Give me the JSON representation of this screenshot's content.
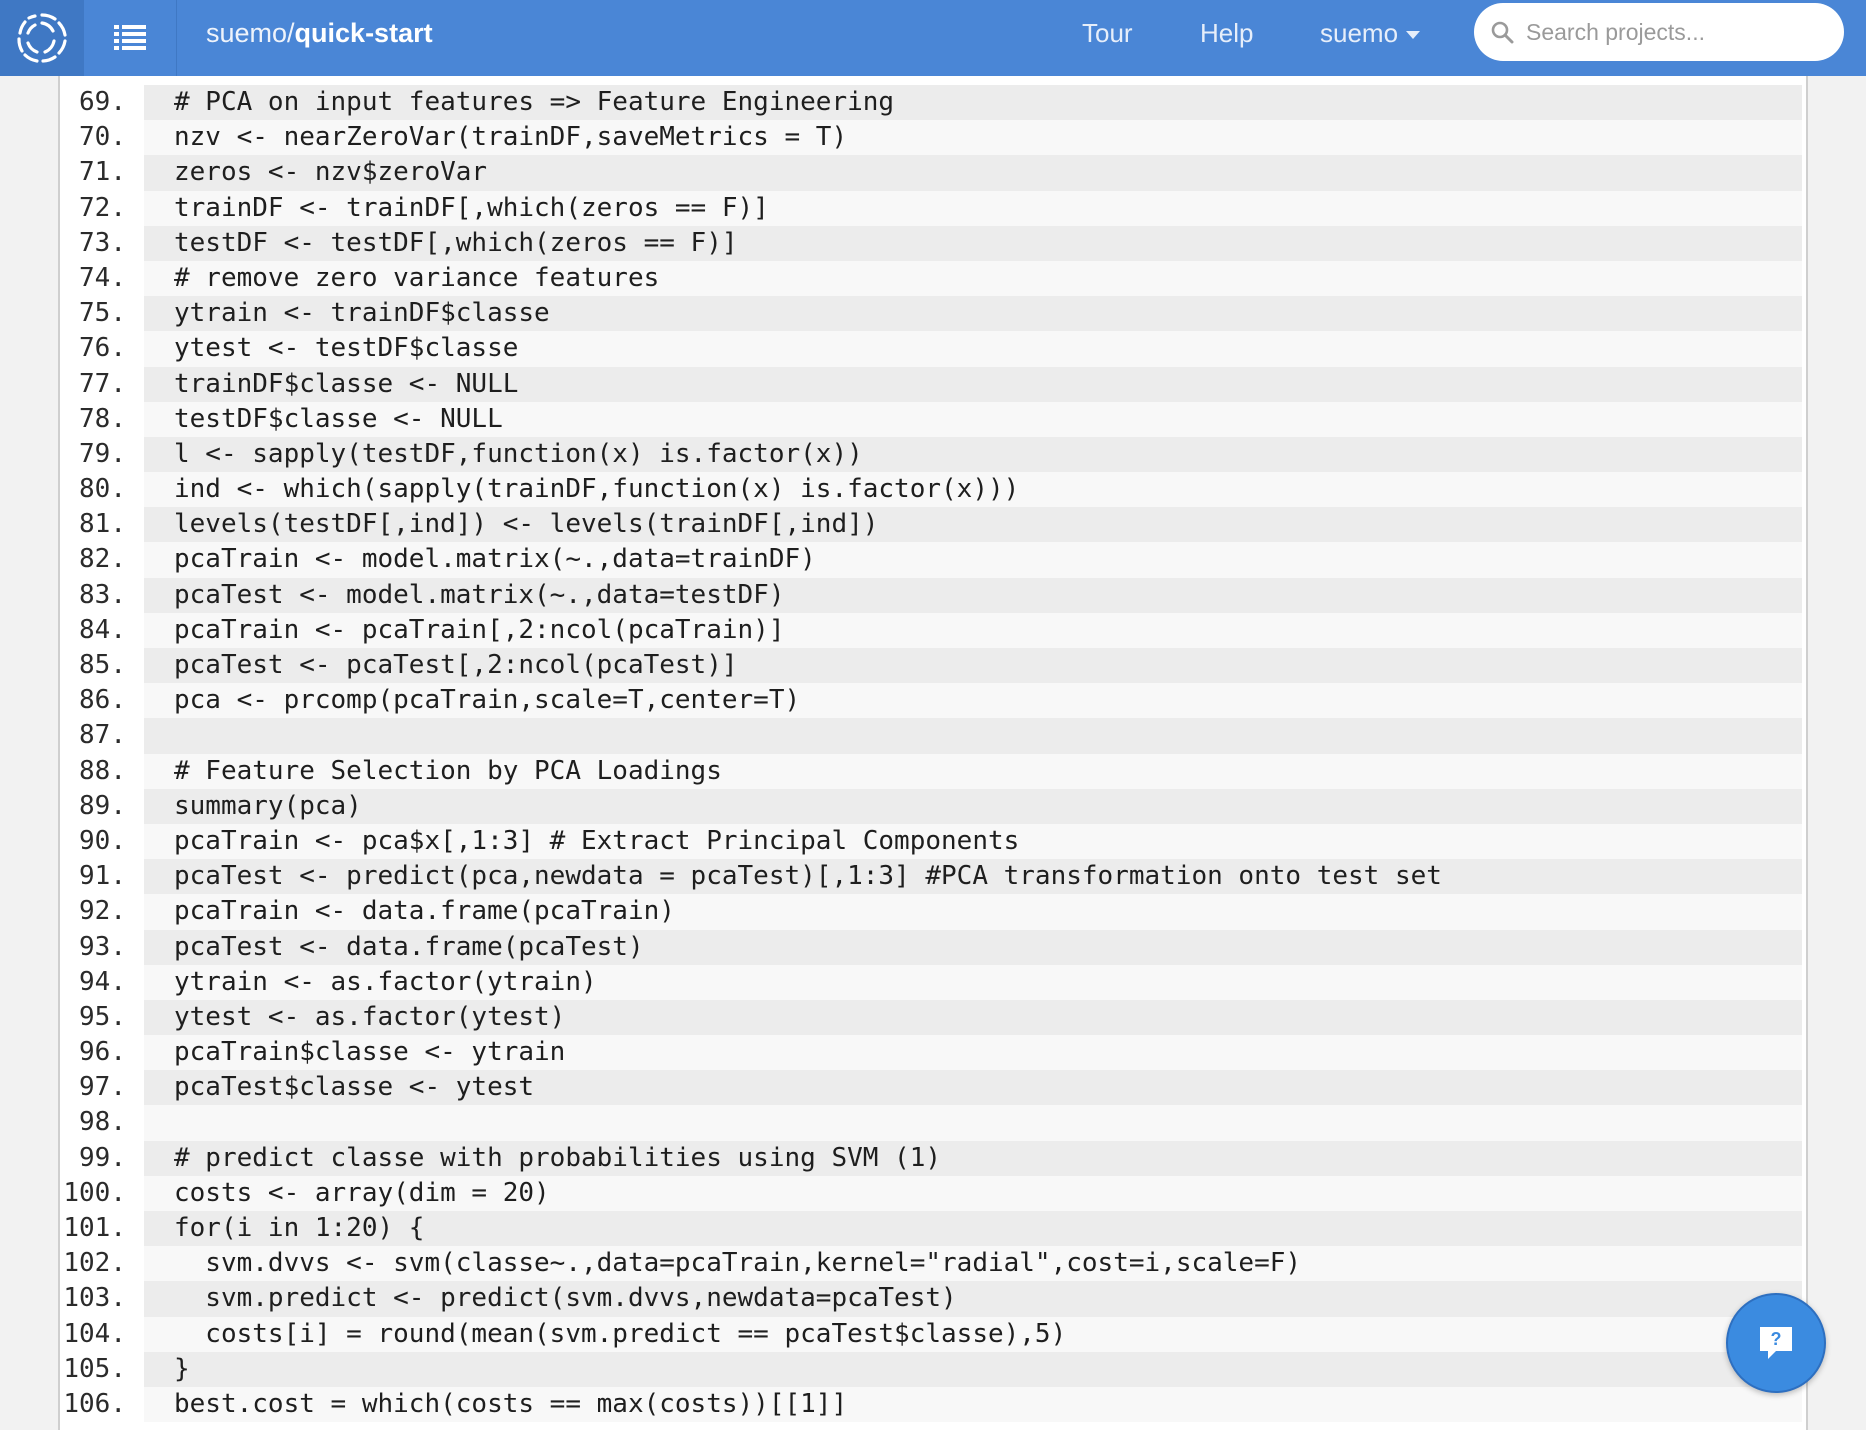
{
  "header": {
    "owner": "suemo/",
    "project": "quick-start",
    "nav": {
      "tour": "Tour",
      "help": "Help",
      "user": "suemo"
    },
    "search_placeholder": "Search projects...",
    "icons": {
      "logo": "spinner-logo-icon",
      "menu": "list-icon",
      "search": "search-icon",
      "help": "help-question-icon"
    },
    "colors": {
      "bar": "#4a86d6",
      "accent": "#3b8be0"
    }
  },
  "code": {
    "lines": [
      {
        "n": "69.",
        "t": "# PCA on input features => Feature Engineering"
      },
      {
        "n": "70.",
        "t": "nzv <- nearZeroVar(trainDF,saveMetrics = T)"
      },
      {
        "n": "71.",
        "t": "zeros <- nzv$zeroVar"
      },
      {
        "n": "72.",
        "t": "trainDF <- trainDF[,which(zeros == F)]"
      },
      {
        "n": "73.",
        "t": "testDF <- testDF[,which(zeros == F)]"
      },
      {
        "n": "74.",
        "t": "# remove zero variance features"
      },
      {
        "n": "75.",
        "t": "ytrain <- trainDF$classe"
      },
      {
        "n": "76.",
        "t": "ytest <- testDF$classe"
      },
      {
        "n": "77.",
        "t": "trainDF$classe <- NULL"
      },
      {
        "n": "78.",
        "t": "testDF$classe <- NULL"
      },
      {
        "n": "79.",
        "t": "l <- sapply(testDF,function(x) is.factor(x))"
      },
      {
        "n": "80.",
        "t": "ind <- which(sapply(trainDF,function(x) is.factor(x)))"
      },
      {
        "n": "81.",
        "t": "levels(testDF[,ind]) <- levels(trainDF[,ind])"
      },
      {
        "n": "82.",
        "t": "pcaTrain <- model.matrix(~.,data=trainDF)"
      },
      {
        "n": "83.",
        "t": "pcaTest <- model.matrix(~.,data=testDF)"
      },
      {
        "n": "84.",
        "t": "pcaTrain <- pcaTrain[,2:ncol(pcaTrain)]"
      },
      {
        "n": "85.",
        "t": "pcaTest <- pcaTest[,2:ncol(pcaTest)]"
      },
      {
        "n": "86.",
        "t": "pca <- prcomp(pcaTrain,scale=T,center=T)"
      },
      {
        "n": "87.",
        "t": ""
      },
      {
        "n": "88.",
        "t": "# Feature Selection by PCA Loadings"
      },
      {
        "n": "89.",
        "t": "summary(pca)"
      },
      {
        "n": "90.",
        "t": "pcaTrain <- pca$x[,1:3] # Extract Principal Components"
      },
      {
        "n": "91.",
        "t": "pcaTest <- predict(pca,newdata = pcaTest)[,1:3] #PCA transformation onto test set"
      },
      {
        "n": "92.",
        "t": "pcaTrain <- data.frame(pcaTrain)"
      },
      {
        "n": "93.",
        "t": "pcaTest <- data.frame(pcaTest)"
      },
      {
        "n": "94.",
        "t": "ytrain <- as.factor(ytrain)"
      },
      {
        "n": "95.",
        "t": "ytest <- as.factor(ytest)"
      },
      {
        "n": "96.",
        "t": "pcaTrain$classe <- ytrain"
      },
      {
        "n": "97.",
        "t": "pcaTest$classe <- ytest"
      },
      {
        "n": "98.",
        "t": ""
      },
      {
        "n": "99.",
        "t": "# predict classe with probabilities using SVM (1)"
      },
      {
        "n": "100.",
        "t": "costs <- array(dim = 20)"
      },
      {
        "n": "101.",
        "t": "for(i in 1:20) {"
      },
      {
        "n": "102.",
        "t": "  svm.dvvs <- svm(classe~.,data=pcaTrain,kernel=\"radial\",cost=i,scale=F)"
      },
      {
        "n": "103.",
        "t": "  svm.predict <- predict(svm.dvvs,newdata=pcaTest)"
      },
      {
        "n": "104.",
        "t": "  costs[i] = round(mean(svm.predict == pcaTest$classe),5)"
      },
      {
        "n": "105.",
        "t": "}"
      },
      {
        "n": "106.",
        "t": "best.cost = which(costs == max(costs))[[1]]"
      }
    ]
  }
}
